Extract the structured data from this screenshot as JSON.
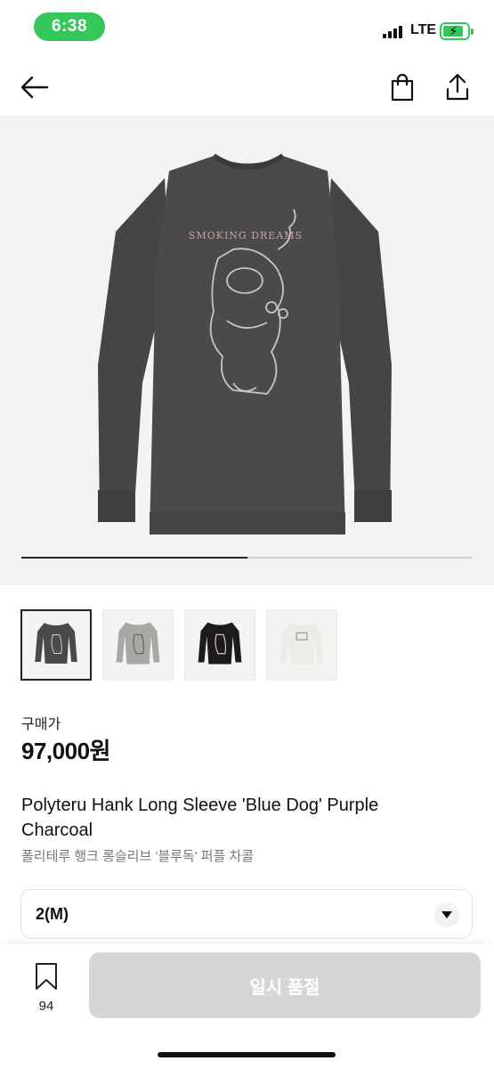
{
  "status_bar": {
    "time": "6:38",
    "network": "LTE",
    "time_pill_color": "#34c759",
    "battery_color": "#34c759"
  },
  "nav": {
    "back_icon": "arrow-left-icon",
    "bag_icon": "shopping-bag-icon",
    "share_icon": "share-icon"
  },
  "gallery": {
    "image_index": 1,
    "image_count": 2,
    "progress": 0.5,
    "thumbnails": [
      {
        "color": "charcoal",
        "selected": true
      },
      {
        "color": "grey",
        "selected": false
      },
      {
        "color": "black",
        "selected": false
      },
      {
        "color": "ivory",
        "selected": false
      }
    ]
  },
  "product": {
    "price_label": "구매가",
    "price": "97,000원",
    "title": "Polyteru Hank Long Sleeve 'Blue Dog' Purple Charcoal",
    "subtitle": "폴리테루 행크 롱슬리브 '블루독' 퍼플 차콜",
    "print_text": "SMOKING DREAMS"
  },
  "size_select": {
    "value": "2(M)",
    "icon": "chevron-down-icon"
  },
  "bottom_bar": {
    "wish_icon": "bookmark-icon",
    "wish_count": "94",
    "buy_label": "일시 품절",
    "buy_color": "#d6d6d6"
  }
}
